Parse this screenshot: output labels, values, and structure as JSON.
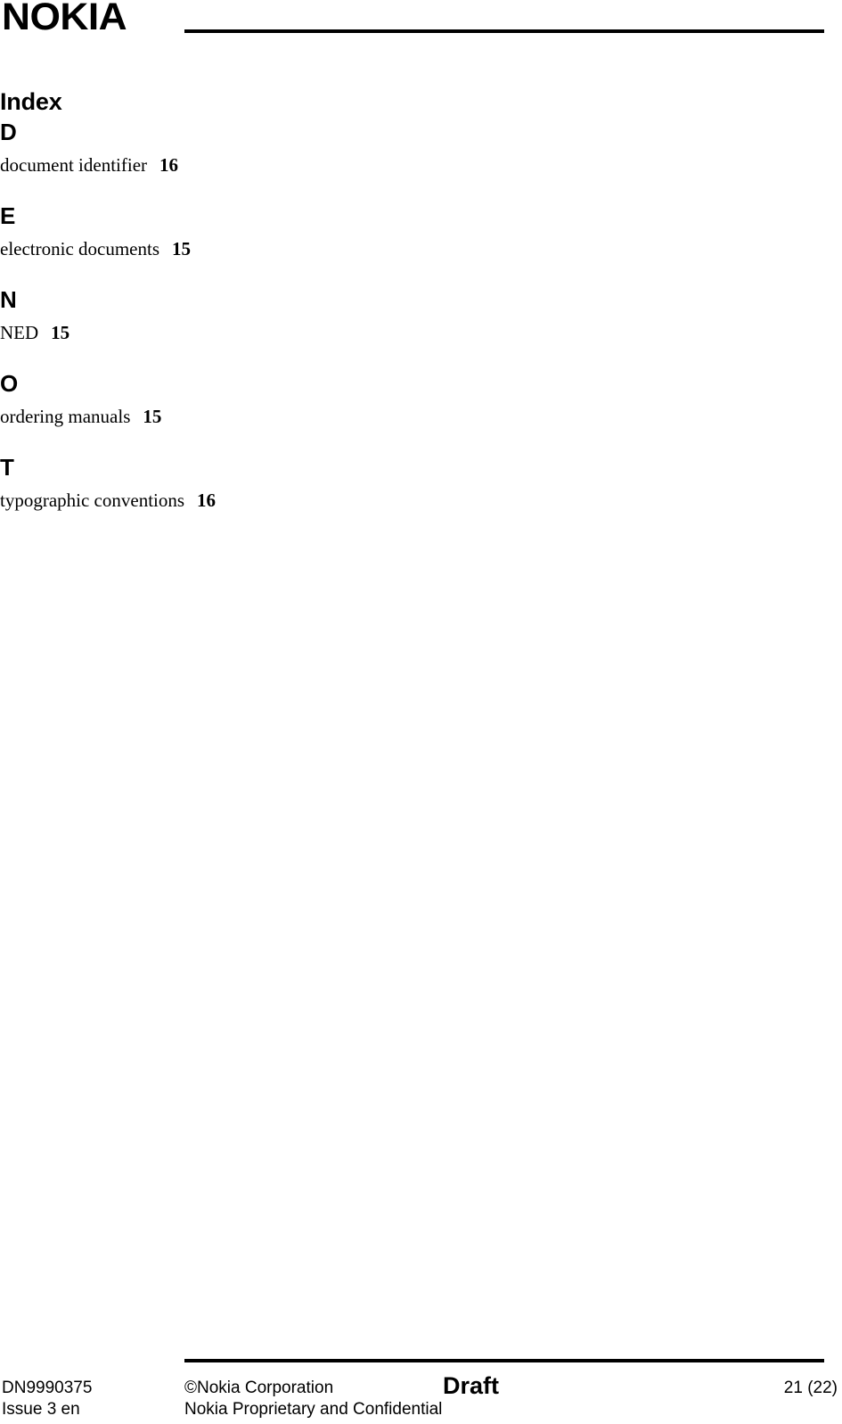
{
  "header": {
    "logo_text": "NOKIA",
    "rule": true
  },
  "document": {
    "title": "Index",
    "groups": [
      {
        "letter": "D",
        "entries": [
          {
            "term": "document identifier",
            "page": "16"
          }
        ]
      },
      {
        "letter": "E",
        "entries": [
          {
            "term": "electronic documents",
            "page": "15"
          }
        ]
      },
      {
        "letter": "N",
        "entries": [
          {
            "term": "NED",
            "page": "15"
          }
        ]
      },
      {
        "letter": "O",
        "entries": [
          {
            "term": "ordering manuals",
            "page": "15"
          }
        ]
      },
      {
        "letter": "T",
        "entries": [
          {
            "term": "typographic conventions",
            "page": "16"
          }
        ]
      }
    ]
  },
  "footer": {
    "doc_id": "DN9990375",
    "issue": "Issue 3 en",
    "copyright": "©Nokia Corporation",
    "confidentiality": "Nokia Proprietary and Confidential",
    "status": "Draft",
    "page_number": "21 (22)"
  },
  "colors": {
    "text": "#000000",
    "background": "#ffffff",
    "rule": "#000000"
  }
}
